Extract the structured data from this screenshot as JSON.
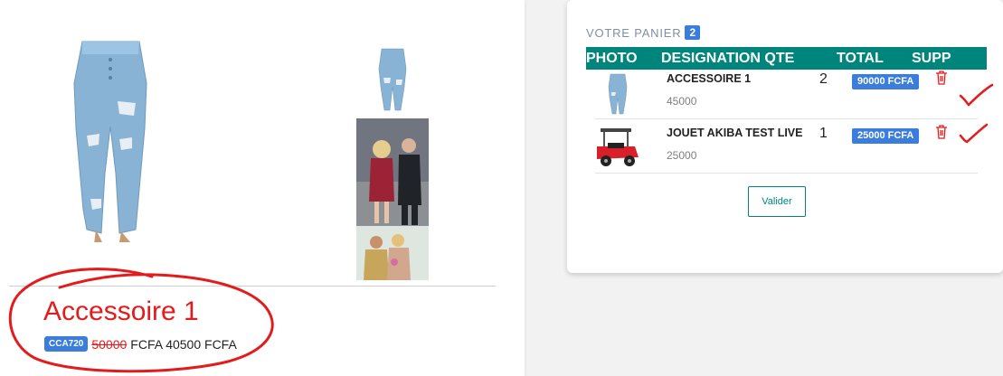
{
  "product": {
    "title": "Accessoire 1",
    "code": "CCA720",
    "old_price": "50000 ",
    "price_text": "FCFA 40500 FCFA",
    "images": {
      "main": "jeans-product-image",
      "thumbnails": [
        "jeans-thumbnail",
        "couple-photo-thumbnail",
        "people-photo-thumbnail"
      ]
    }
  },
  "cart": {
    "title": "VOTRE PANIER",
    "count": "2",
    "headers": {
      "photo": "PHOTO",
      "designation": "DESIGNATION",
      "qty": "QTE",
      "total": "TOTAL",
      "supp": "SUPP"
    },
    "items": [
      {
        "name": "ACCESSOIRE 1",
        "unit_price": "45000",
        "qty": "2",
        "total": "90000 FCFA",
        "image": "jeans-thumbnail"
      },
      {
        "name": "JOUET AKIBA TEST LIVE",
        "unit_price": "25000",
        "qty": "1",
        "total": "25000 FCFA",
        "image": "red-toy-car-thumbnail"
      }
    ],
    "validate_label": "Valider"
  },
  "colors": {
    "accent_blue": "#3b7ddd",
    "header_teal": "#00857c",
    "annotation_red": "#e41b1b"
  },
  "icons": {
    "delete": "trash-icon",
    "annotation": "checkmark-icon"
  }
}
